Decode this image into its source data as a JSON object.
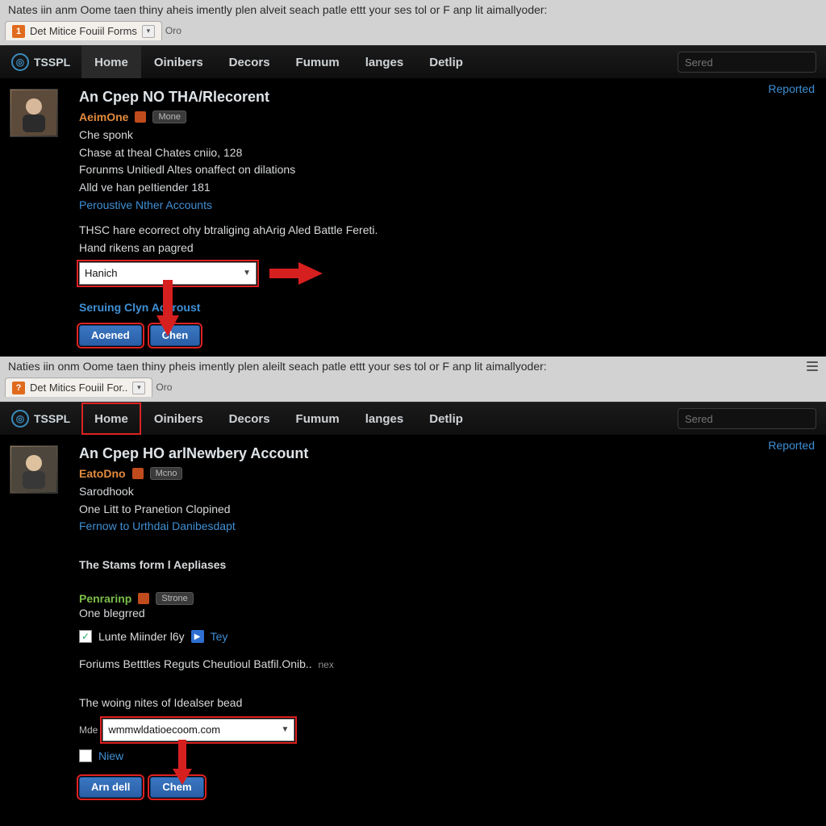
{
  "browser": {
    "info_bar_top": "Nates iin anm Oome taen thiny aheis imently plen alveit seach patle ettt your ses tol or F anp lit aimallyoder:",
    "tab_title_top": "Det Mitice Fouiil Forms",
    "tab_drop_label": "Oro",
    "info_bar_bottom": "Naties iin onm Oome taen thiny pheis imently plen aleilt seach patle ettt your ses tol or F anp lit aimallyoder:",
    "tab_title_bottom": "Det Mitics Fouiil For.."
  },
  "nav": {
    "brand": "TSSPL",
    "items": [
      "Home",
      "Oinibers",
      "Decors",
      "Fumum",
      "langes",
      "Detlip"
    ],
    "search_placeholder": "Sered"
  },
  "top_post": {
    "title": "An Cpep NO THA/Rlecorent",
    "username": "AeimOne",
    "badge": "Mone",
    "reported": "Reported",
    "lines": [
      "Che sponk",
      "Chase at theal Chates cniio, 128",
      "Forunms Unitiedl Altes onaffect on dilations",
      "Alld ve han peItiender 181"
    ],
    "accounts_link": "Peroustive Nther Accounts",
    "body1": "THSC hare ecorrect ohy btraliging ahArig Aled Battle Fereti.",
    "body2": "Hand rikens an pagred",
    "combo_value": "Hanich",
    "serving_link": "Seruing Clyn  Accroust",
    "btn_primary": "Aoened",
    "btn_secondary": "Chen"
  },
  "bottom_post": {
    "title": "An Cpep HO arlNewbery Account",
    "username": "EatoDno",
    "badge": "Mcno",
    "reported": "Reported",
    "lines": [
      "Sarodhook",
      "One Litt to Pranetion Clopined"
    ],
    "link1": "Fernow to Urthdai Danibesdapt",
    "section_title": "The Stams form l Aepliases",
    "sub_username": "Penrarinp",
    "sub_badge": "Strone",
    "sub_line": "One blegrred",
    "chk1_label": "Lunte Miinder l6y",
    "chk1_side": "Tey",
    "forum_line": "Foriums Betttles Reguts Cheutioul Batfil.Onib..",
    "forum_line_suffix": "nex",
    "input_note": "The woing nites of Idealser bead",
    "combo_label": "Mde",
    "combo_value": "wmmwldatioecoom.com",
    "chk2_label": "Niew",
    "btn_primary": "Arn dell",
    "btn_secondary": "Chem"
  }
}
